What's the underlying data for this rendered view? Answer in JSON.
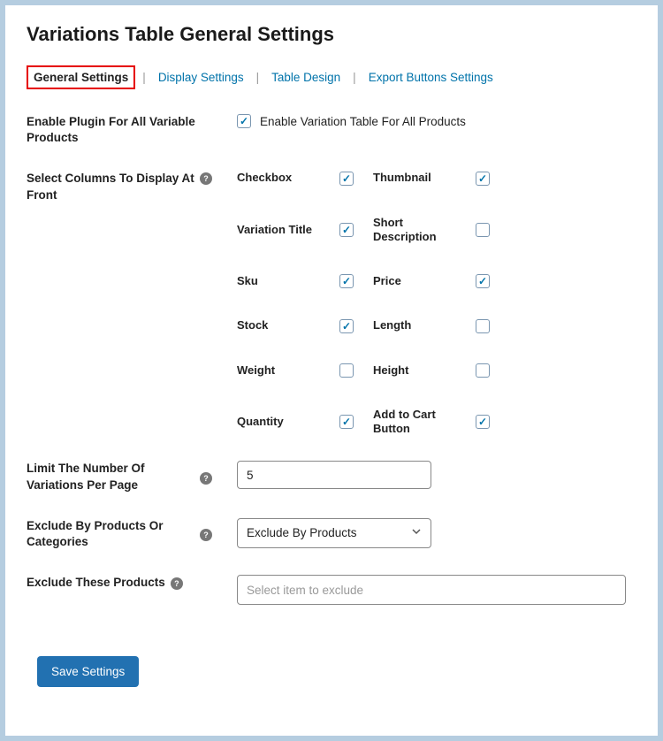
{
  "title": "Variations Table General Settings",
  "tabs": {
    "general": "General Settings",
    "display": "Display Settings",
    "table_design": "Table Design",
    "export": "Export Buttons Settings"
  },
  "labels": {
    "enable_all": "Enable Plugin For All Variable Products",
    "enable_all_checkbox": "Enable Variation Table For All Products",
    "select_columns": "Select Columns To Display At Front",
    "limit": "Limit The Number Of Variations Per Page",
    "exclude_by": "Exclude By Products Or Categories",
    "exclude_products": "Exclude These Products"
  },
  "columns": [
    {
      "label": "Checkbox",
      "checked": true
    },
    {
      "label": "Thumbnail",
      "checked": true
    },
    {
      "label": "Variation Title",
      "checked": true
    },
    {
      "label": "Short Description",
      "checked": false
    },
    {
      "label": "Sku",
      "checked": true
    },
    {
      "label": "Price",
      "checked": true
    },
    {
      "label": "Stock",
      "checked": true
    },
    {
      "label": "Length",
      "checked": false
    },
    {
      "label": "Weight",
      "checked": false
    },
    {
      "label": "Height",
      "checked": false
    },
    {
      "label": "Quantity",
      "checked": true
    },
    {
      "label": "Add to Cart Button",
      "checked": true
    }
  ],
  "fields": {
    "enable_all_checked": true,
    "limit_value": "5",
    "exclude_by_selected": "Exclude By Products",
    "exclude_products_placeholder": "Select item to exclude"
  },
  "buttons": {
    "save": "Save Settings"
  }
}
